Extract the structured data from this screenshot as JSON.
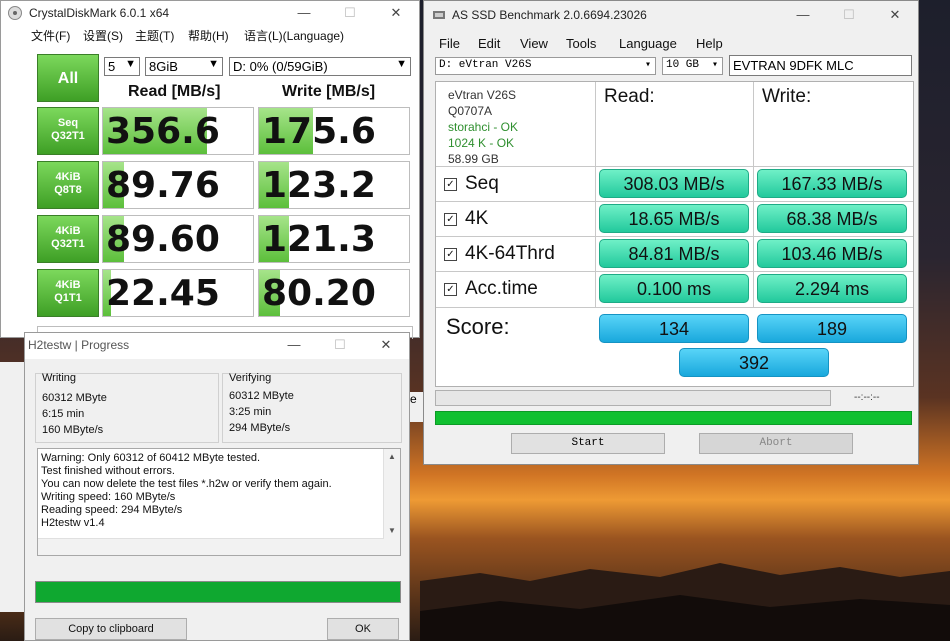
{
  "cdm": {
    "title": "CrystalDiskMark 6.0.1 x64",
    "menu": [
      "文件(F)",
      "设置(S)",
      "主题(T)",
      "帮助(H)",
      "语言(L)(Language)"
    ],
    "all_label": "All",
    "count": "5",
    "size": "8GiB",
    "drive": "D: 0% (0/59GiB)",
    "read_header": "Read [MB/s]",
    "write_header": "Write [MB/s]",
    "rows": [
      {
        "l1": "Seq",
        "l2": "Q32T1",
        "read": "356.6",
        "write": "175.6",
        "read_fill": 0.69,
        "write_fill": 0.36
      },
      {
        "l1": "4KiB",
        "l2": "Q8T8",
        "read": "89.76",
        "write": "123.2",
        "read_fill": 0.14,
        "write_fill": 0.2
      },
      {
        "l1": "4KiB",
        "l2": "Q32T1",
        "read": "89.60",
        "write": "121.3",
        "read_fill": 0.14,
        "write_fill": 0.2
      },
      {
        "l1": "4KiB",
        "l2": "Q1T1",
        "read": "22.45",
        "write": "80.20",
        "read_fill": 0.05,
        "write_fill": 0.14
      }
    ]
  },
  "h2w": {
    "title": "H2testw | Progress",
    "writing": {
      "label": "Writing",
      "size": "60312 MByte",
      "time": "6:15 min",
      "speed": "160 MByte/s"
    },
    "verifying": {
      "label": "Verifying",
      "size": "60312 MByte",
      "time": "3:25 min",
      "speed": "294 MByte/s"
    },
    "log": [
      "Warning: Only 60312 of 60412 MByte tested.",
      "Test finished without errors.",
      "You can now delete the test files *.h2w or verify them again.",
      "Writing speed: 160 MByte/s",
      "Reading speed: 294 MByte/s",
      "H2testw v1.4"
    ],
    "copy_label": "Copy to clipboard",
    "ok_label": "OK",
    "progress": 1.0
  },
  "asssd": {
    "title": "AS SSD Benchmark 2.0.6694.23026",
    "menu": [
      "File",
      "Edit",
      "View",
      "Tools",
      "Language",
      "Help"
    ],
    "drive": "D: eVtran V26S",
    "size": "10 GB",
    "name_field": "EVTRAN 9DFK MLC",
    "info": {
      "model": "eVtran V26S",
      "fw": "Q0707A",
      "driver": "storahci - OK",
      "align": "1024 K - OK",
      "capacity": "58.99 GB"
    },
    "read_header": "Read:",
    "write_header": "Write:",
    "rows": [
      {
        "label": "Seq",
        "read": "308.03 MB/s",
        "write": "167.33 MB/s"
      },
      {
        "label": "4K",
        "read": "18.65 MB/s",
        "write": "68.38 MB/s"
      },
      {
        "label": "4K-64Thrd",
        "read": "84.81 MB/s",
        "write": "103.46 MB/s"
      },
      {
        "label": "Acc.time",
        "read": "0.100 ms",
        "write": "2.294 ms"
      }
    ],
    "score_label": "Score:",
    "score_read": "134",
    "score_write": "189",
    "score_total": "392",
    "time_text": "--:--:--",
    "start_label": "Start",
    "abort_label": "Abort",
    "progress": 1.0
  },
  "colors": {
    "cdm_green": "#3e9f25",
    "as_teal": "#22c99c",
    "as_blue": "#19a8dc",
    "progress_green": "#10c030"
  }
}
